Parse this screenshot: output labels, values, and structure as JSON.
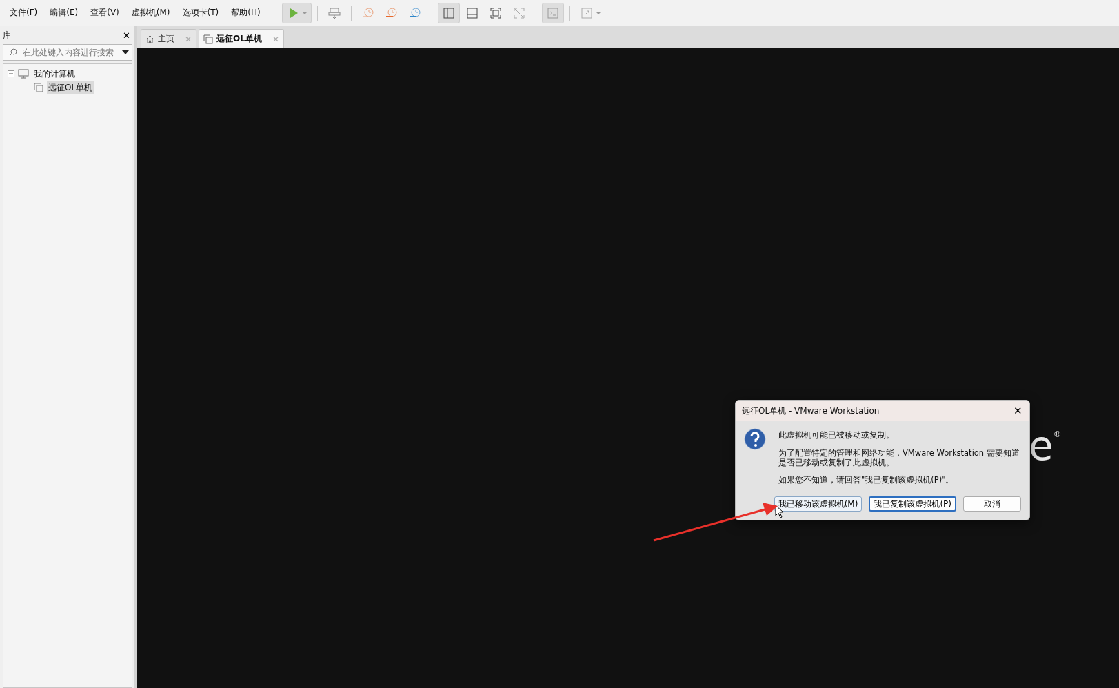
{
  "menu": [
    {
      "label": "文件(F)"
    },
    {
      "label": "编辑(E)"
    },
    {
      "label": "查看(V)"
    },
    {
      "label": "虚拟机(M)"
    },
    {
      "label": "选项卡(T)"
    },
    {
      "label": "帮助(H)"
    }
  ],
  "toolbar": [
    {
      "kind": "power",
      "selected": true
    },
    {
      "kind": "sep"
    },
    {
      "kind": "sendkeys",
      "selected": false
    },
    {
      "kind": "sep"
    },
    {
      "kind": "snap-take",
      "selected": false
    },
    {
      "kind": "snap-revert",
      "selected": false
    },
    {
      "kind": "snap-manage",
      "selected": false
    },
    {
      "kind": "sep"
    },
    {
      "kind": "view-library",
      "selected": true
    },
    {
      "kind": "view-bottom",
      "selected": false
    },
    {
      "kind": "view-full",
      "selected": false
    },
    {
      "kind": "view-unity",
      "selected": false
    },
    {
      "kind": "sep"
    },
    {
      "kind": "console",
      "selected": true
    },
    {
      "kind": "sep"
    },
    {
      "kind": "stretch",
      "selected": false
    }
  ],
  "sidebar": {
    "title": "库",
    "close": "✕",
    "search": {
      "placeholder": "在此处键入内容进行搜索"
    },
    "tree": [
      {
        "label": "我的计算机",
        "expanded": true,
        "selected": false,
        "children": [
          {
            "label": "远征OL单机",
            "selected": true
          }
        ]
      }
    ]
  },
  "tabs": [
    {
      "label": "主页",
      "kind": "home",
      "selected": false,
      "close": "✕"
    },
    {
      "label": "远征OL单机",
      "kind": "vm",
      "selected": true,
      "close": "✕"
    }
  ],
  "logo": {
    "text": "e",
    "mark": "®"
  },
  "dialog": {
    "title": "远征OL单机 - VMware Workstation",
    "close": "✕",
    "messages": [
      "此虚拟机可能已被移动或复制。",
      "为了配置特定的管理和网络功能，VMware Workstation 需要知道是否已移动或复制了此虚拟机。",
      "如果您不知道，请回答\"我已复制该虚拟机(P)\"。"
    ],
    "buttons": [
      {
        "label": "我已移动该虚拟机(M)",
        "hovered": true,
        "default": false
      },
      {
        "label": "我已复制该虚拟机(P)",
        "hovered": false,
        "default": true
      },
      {
        "label": "取消",
        "hovered": false,
        "default": false
      }
    ]
  }
}
